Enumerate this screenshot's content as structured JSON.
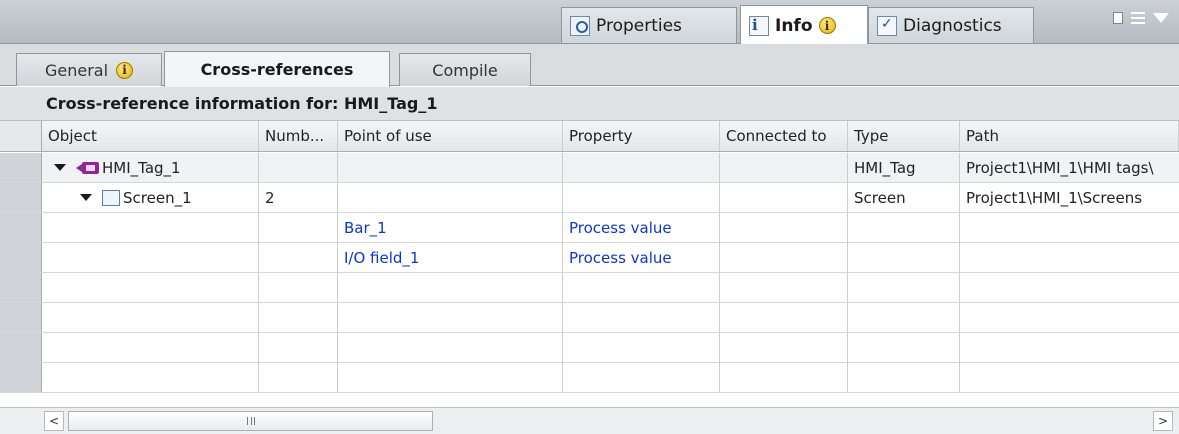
{
  "inspector_tabs": [
    {
      "label": "Properties",
      "icon": "properties-icon",
      "active": false
    },
    {
      "label": "Info",
      "icon": "info-icon",
      "active": true,
      "badge": "i"
    },
    {
      "label": "Diagnostics",
      "icon": "diagnostics-icon",
      "active": false
    }
  ],
  "sub_tabs": [
    {
      "label": "General",
      "badge": "i",
      "active": false
    },
    {
      "label": "Cross-references",
      "active": true
    },
    {
      "label": "Compile",
      "active": false
    }
  ],
  "title": "Cross-reference information for: HMI_Tag_1",
  "columns": [
    "Object",
    "Numb...",
    "Point of use",
    "Property",
    "Connected to",
    "Type",
    "Path"
  ],
  "rows": [
    {
      "object": "HMI_Tag_1",
      "object_icon": "hmi-tag-icon",
      "expanded": true,
      "level": 0,
      "number": "",
      "point_of_use": "",
      "property": "",
      "connected_to": "",
      "type": "HMI_Tag",
      "path": "Project1\\HMI_1\\HMI tags\\"
    },
    {
      "object": "Screen_1",
      "object_icon": "screen-icon",
      "expanded": true,
      "level": 1,
      "number": "2",
      "point_of_use": "",
      "property": "",
      "connected_to": "",
      "type": "Screen",
      "path": "Project1\\HMI_1\\Screens"
    },
    {
      "object": "",
      "number": "",
      "point_of_use": "Bar_1",
      "property": "Process value",
      "connected_to": "",
      "type": "",
      "path": ""
    },
    {
      "object": "",
      "number": "",
      "point_of_use": "I/O field_1",
      "property": "Process value",
      "connected_to": "",
      "type": "",
      "path": ""
    }
  ],
  "scrollbar": {
    "left_arrow": "<",
    "right_arrow": ">"
  },
  "colors": {
    "link": "#0b35d8",
    "tag_icon": "#8c2a91",
    "badge": "#e6b300"
  }
}
